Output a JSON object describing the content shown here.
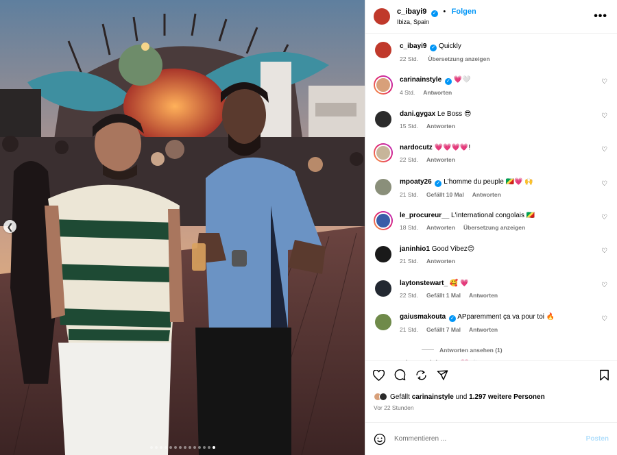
{
  "post": {
    "author": "c_ibayi9",
    "location": "Ibiza, Spain",
    "follow_label": "Folgen",
    "more_label": "•••",
    "carousel": {
      "dots": 14,
      "active_index": 13
    }
  },
  "caption": {
    "username": "c_ibayi9",
    "text": "Quickly",
    "time": "22 Std.",
    "translate": "Übersetzung anzeigen"
  },
  "comments": [
    {
      "username": "carinainstyle",
      "verified": true,
      "text": "💗🤍",
      "time": "4 Std.",
      "likes": "",
      "reply": "Antworten",
      "translate": "",
      "avatar_color": "#d8a07a",
      "ring": true
    },
    {
      "username": "dani.gygax",
      "verified": false,
      "text": "Le Boss 😎",
      "time": "15 Std.",
      "likes": "",
      "reply": "Antworten",
      "translate": "",
      "avatar_color": "#2b2b2b",
      "ring": false
    },
    {
      "username": "nardocutz",
      "verified": false,
      "text": "💗💗💗💗!",
      "time": "22 Std.",
      "likes": "",
      "reply": "Antworten",
      "translate": "",
      "avatar_color": "#c7b59a",
      "ring": true
    },
    {
      "username": "mpoaty26",
      "verified": true,
      "text": "L'homme du peuple 🇨🇬💗 🙌",
      "time": "21 Std.",
      "likes": "Gefällt 10 Mal",
      "reply": "Antworten",
      "translate": "",
      "avatar_color": "#8a8f7a",
      "ring": false
    },
    {
      "username": "le_procureur__",
      "verified": false,
      "text": "L'international congolais 🇨🇬",
      "time": "18 Std.",
      "likes": "",
      "reply": "Antworten",
      "translate": "Übersetzung anzeigen",
      "avatar_color": "#3a5da8",
      "ring": true
    },
    {
      "username": "janinhio1",
      "verified": false,
      "text": "Good Vibez😍",
      "time": "21 Std.",
      "likes": "",
      "reply": "Antworten",
      "translate": "",
      "avatar_color": "#1a1a1a",
      "ring": false
    },
    {
      "username": "laytonstewart_",
      "verified": false,
      "text": "🥰 💗",
      "time": "22 Std.",
      "likes": "Gefällt 1 Mal",
      "reply": "Antworten",
      "translate": "",
      "avatar_color": "#222831",
      "ring": false
    },
    {
      "username": "gaiusmakouta",
      "verified": true,
      "text": "APparemment ça va pour toi 🔥",
      "time": "21 Std.",
      "likes": "Gefällt 7 Mal",
      "reply": "Antworten",
      "translate": "",
      "avatar_color": "#6f8a4a",
      "ring": false
    },
    {
      "username": "ethan.meichtry",
      "verified": true,
      "text": "💗 🙌",
      "time": "",
      "likes": "",
      "reply": "",
      "translate": "",
      "avatar_color": "#9a8576",
      "ring": false
    }
  ],
  "view_replies": "Antworten ansehen (1)",
  "likes_summary": {
    "prefix": "Gefällt",
    "user": "carinainstyle",
    "middle": "und",
    "count": "1.297 weitere Personen"
  },
  "post_time": "Vor 22 Stunden",
  "composer": {
    "placeholder": "Kommentieren ...",
    "post_label": "Posten"
  },
  "colors": {
    "accent": "#0095f6",
    "like_red": "#ff3040",
    "muted": "#737373"
  },
  "icons": [
    "heart-icon",
    "comment-icon",
    "share-icon",
    "send-icon",
    "bookmark-icon",
    "emoji-icon",
    "more-icon",
    "chevron-left-icon",
    "verified-icon"
  ]
}
